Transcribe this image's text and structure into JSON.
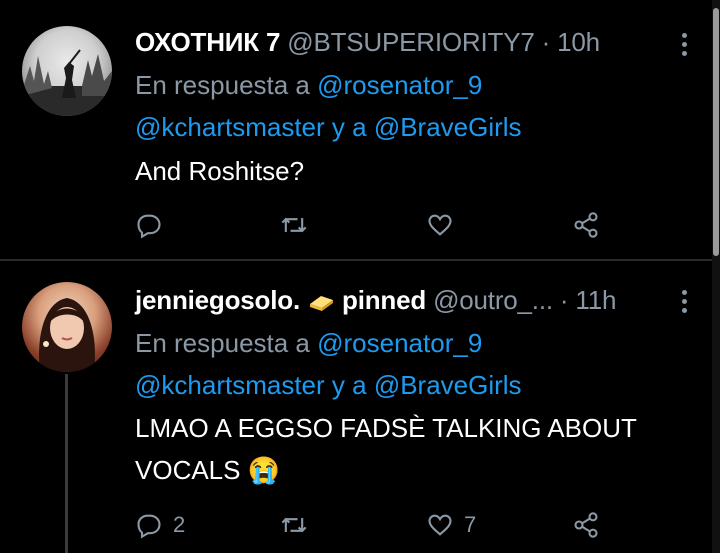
{
  "tweets": [
    {
      "name": "ОХОТНИК 7",
      "handle": "@BTSUPERIORITY7",
      "separator": "·",
      "time": "10h",
      "reply_prefix": "En respuesta a",
      "reply_to_1": "@rosenator_9",
      "reply_to_2": "@kchartsmaster",
      "reply_joiner": "y a",
      "reply_to_3": "@BraveGirls",
      "body_line_1": "And Roshitse?",
      "reply_count": "",
      "like_count": ""
    },
    {
      "name": "jenniegosolo.",
      "name_suffix": "pinned",
      "handle": "@outro_...",
      "separator": "·",
      "time": "11h",
      "reply_prefix": "En respuesta a",
      "reply_to_1": "@rosenator_9",
      "reply_to_2": "@kchartsmaster",
      "reply_joiner": "y a",
      "reply_to_3": "@BraveGirls",
      "body_line_1": "LMAO A EGGSO FADSÈ TALKING ABOUT",
      "body_line_2": "VOCALS",
      "body_emoji": "😭",
      "reply_count": "2",
      "like_count": "7"
    }
  ],
  "icons": {
    "reply": "reply-icon",
    "retweet": "retweet-icon",
    "like": "heart-icon",
    "share": "share-icon",
    "more": "more-vertical-icon",
    "butter": "butter-emoji-icon"
  },
  "colors": {
    "background": "#000000",
    "link": "#1d9bf0",
    "muted": "#8b98a5"
  }
}
